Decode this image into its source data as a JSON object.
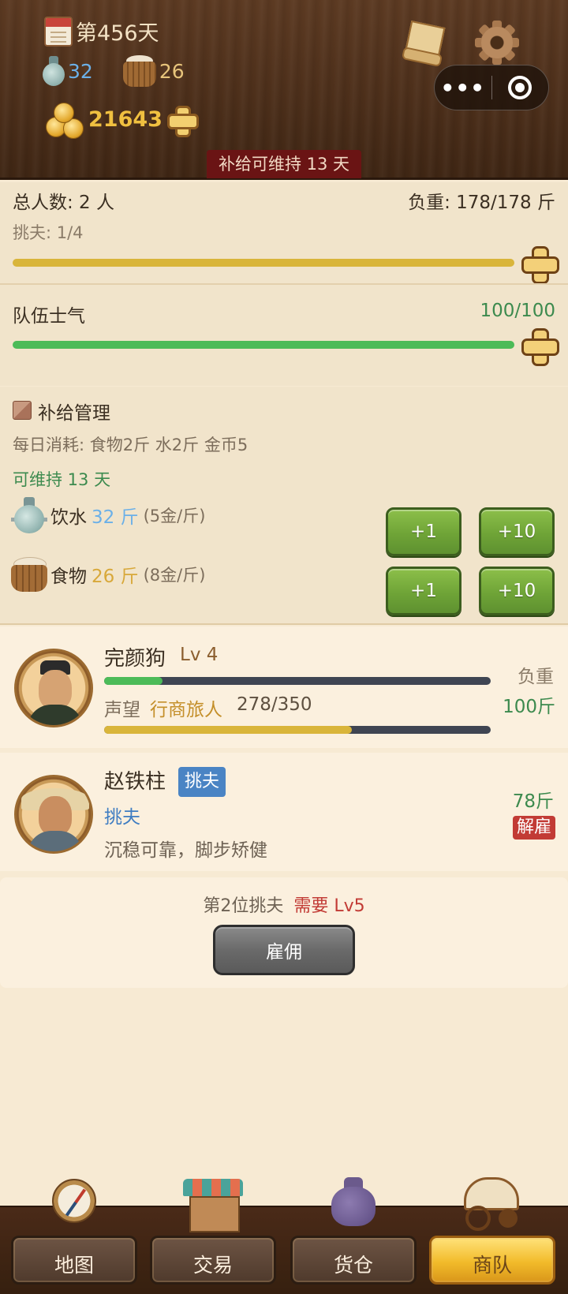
{
  "header": {
    "day_label": "第456天",
    "water": "32",
    "food": "26",
    "gold": "21643",
    "supply_banner": "补给可维持 13 天",
    "icons": [
      "calendar-icon",
      "water-jar-icon",
      "grain-basket-icon",
      "gold-coins-icon",
      "plus-icon",
      "scroll-icon",
      "gear-icon"
    ],
    "capsule": {
      "more": "•••"
    }
  },
  "team": {
    "total_people": "总人数: 2 人",
    "load": "负重: 178/178 斤",
    "porters": "挑夫: 1/4",
    "porters_fill": 1.0,
    "morale_label": "队伍士气",
    "morale_value": "100/100",
    "morale_fill": 1.0
  },
  "supply": {
    "title": "补给管理",
    "daily": "每日消耗: 食物2斤 水2斤 金币5",
    "lasts": "可维持 13 天",
    "water": {
      "name": "饮水",
      "amount": "32 斤",
      "price": "(5金/斤)"
    },
    "food": {
      "name": "食物",
      "amount": "26 斤",
      "price": "(8金/斤)"
    },
    "btn_plus1": "+1",
    "btn_plus10": "+10"
  },
  "leader": {
    "name": "完颜狗",
    "level": "Lv 4",
    "xp_fill": 0.15,
    "rep_label": "声望",
    "rep_title": "行商旅人",
    "rep_value": "278/350",
    "rep_fill": 0.64,
    "load_label": "负重",
    "load_value": "100斤"
  },
  "porter": {
    "name": "赵铁柱",
    "badge": "挑夫",
    "role": "挑夫",
    "desc": "沉稳可靠，脚步矫健",
    "load": "78斤",
    "fire": "解雇"
  },
  "hire": {
    "text": "第2位挑夫",
    "req": "需要 Lv5",
    "button": "雇佣"
  },
  "nav": {
    "map": "地图",
    "trade": "交易",
    "warehouse": "货仓",
    "caravan": "商队",
    "active": "caravan"
  },
  "colors": {
    "gold_bar": "#d9b53a",
    "green_bar": "#4cbb58",
    "accent_green": "#3c8a4e",
    "water_blue": "#6bb0e8",
    "food_yellow": "#d8a83a",
    "danger_red": "#c23b35"
  }
}
